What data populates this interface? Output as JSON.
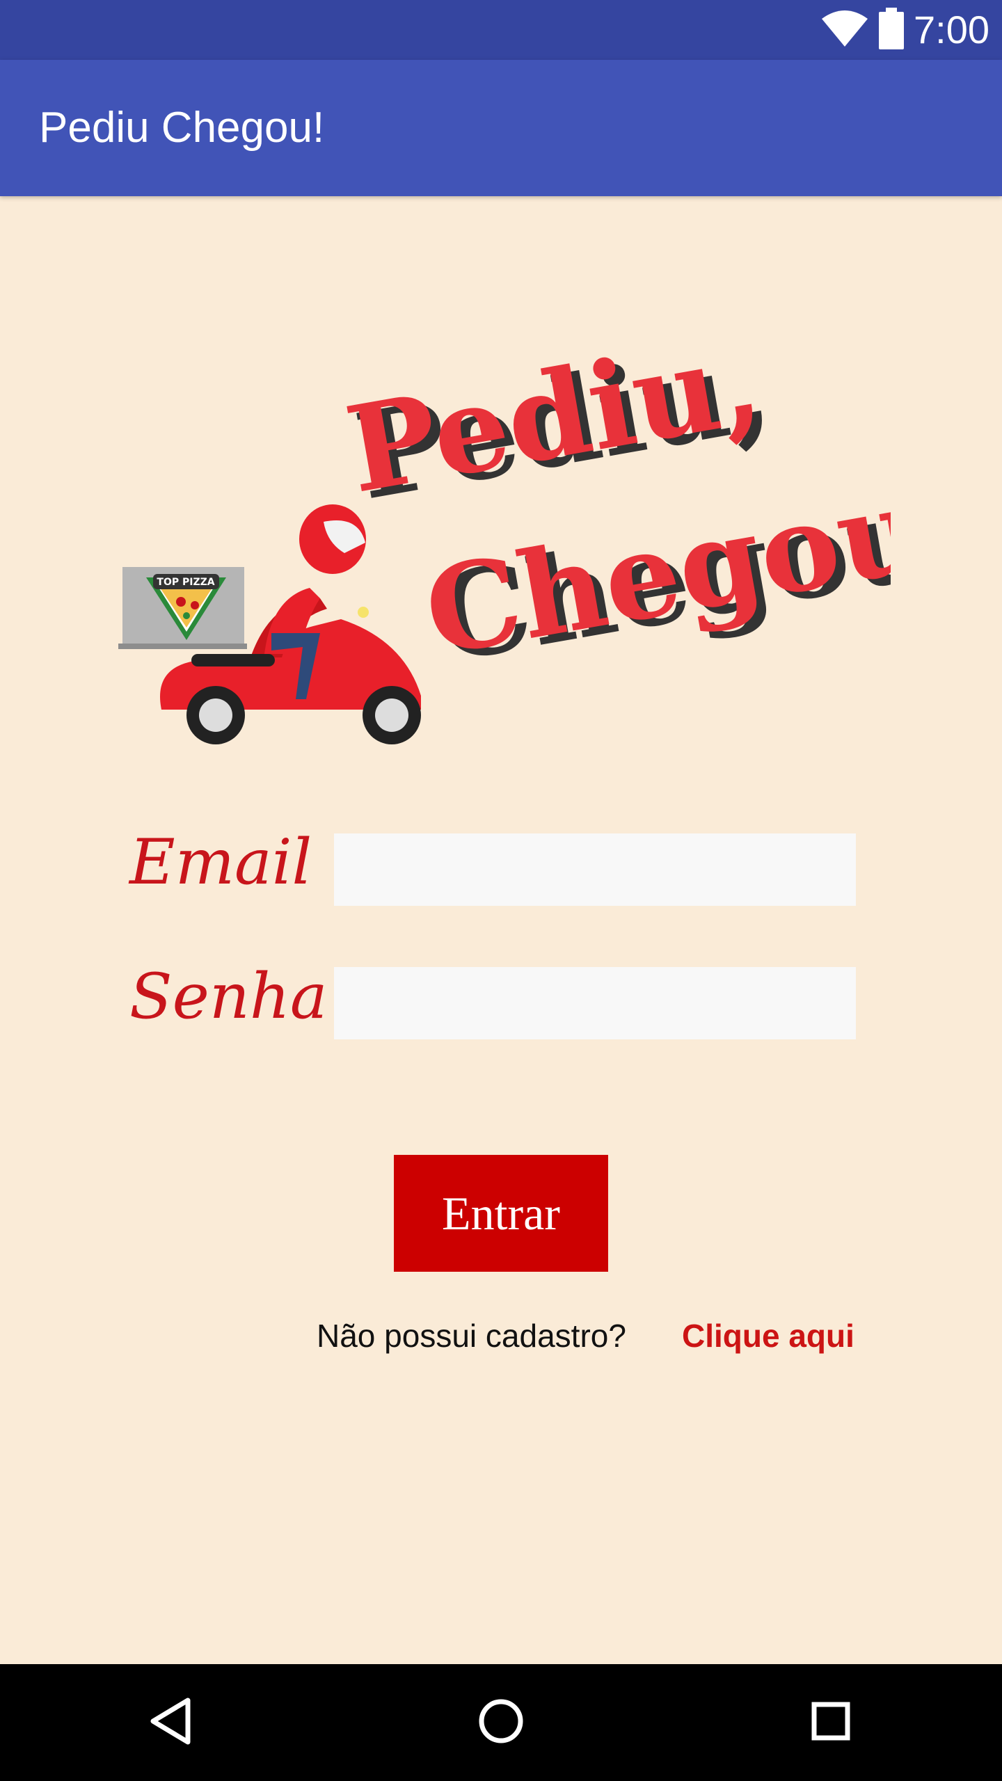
{
  "status_bar": {
    "time": "7:00",
    "icons": [
      "wifi-icon",
      "battery-icon"
    ]
  },
  "app_bar": {
    "title": "Pediu Chegou!"
  },
  "logo": {
    "line1": "Pediu,",
    "line2": "Chegou !",
    "box_text": "TOP PIZZA"
  },
  "form": {
    "email_label": "Email :",
    "email_value": "",
    "senha_label": "Senha :",
    "senha_value": "",
    "submit_label": "Entrar"
  },
  "signup": {
    "question": "Não possui cadastro?",
    "link_label": "Clique aqui"
  },
  "nav_bar": {
    "icons": [
      "back-icon",
      "home-icon",
      "recents-icon"
    ]
  },
  "colors": {
    "status_bar": "#3545a0",
    "app_bar": "#4154b7",
    "background": "#faebd7",
    "accent_red": "#cc0000",
    "input_bg": "#f8f8f8"
  }
}
